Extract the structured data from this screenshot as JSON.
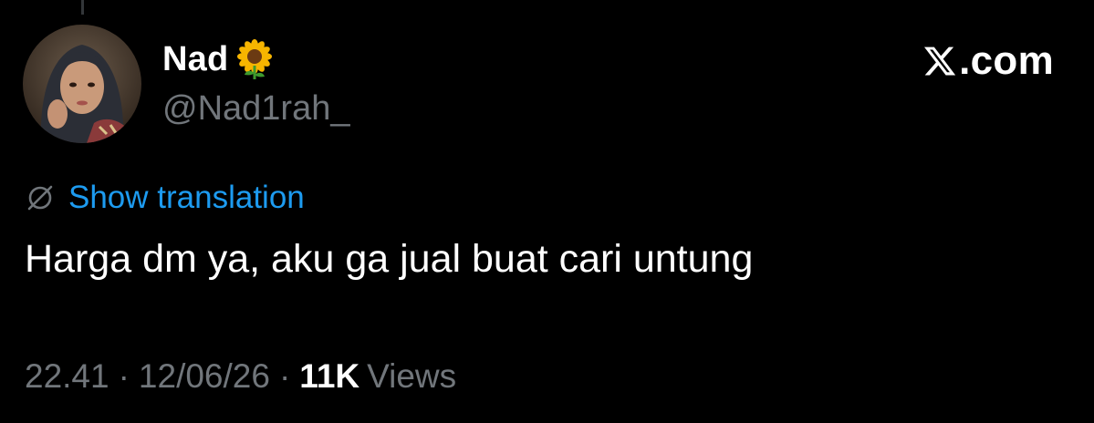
{
  "tweet": {
    "author": {
      "display_name": "Nad",
      "name_emoji": "🌻",
      "handle": "@Nad1rah_",
      "avatar": "woman-in-hijab-portrait"
    },
    "brand": {
      "label": ".com",
      "logo_icon": "x-logo-icon"
    },
    "translation": {
      "icon": "globe-slash-icon",
      "label": "Show translation"
    },
    "text": "Harga dm ya, aku ga jual buat cari untung",
    "meta": {
      "time": "22.41",
      "separator": "·",
      "date": "12/06/26",
      "views_count": "11K",
      "views_label": "Views"
    }
  },
  "colors": {
    "background": "#000000",
    "primary_text": "#ffffff",
    "secondary_text": "#71767b",
    "link": "#1d9bf0"
  }
}
